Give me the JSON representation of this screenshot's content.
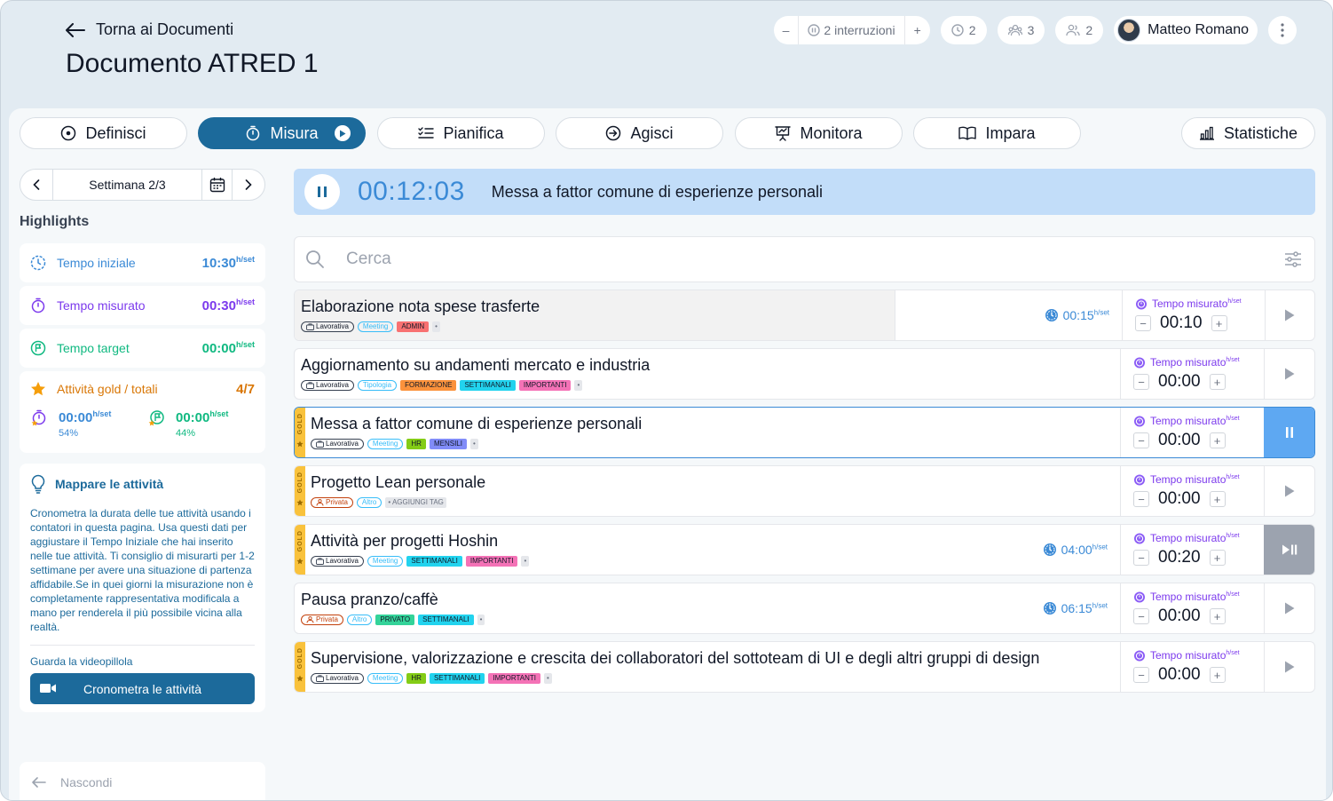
{
  "header": {
    "back_label": "Torna ai Documenti",
    "title": "Documento ATRED 1",
    "interruptions_minus": "–",
    "interruptions_label": "2 interruzioni",
    "interruptions_plus": "+",
    "timers_count": "2",
    "team_count": "3",
    "users_count": "2",
    "user_name": "Matteo Romano"
  },
  "tabs": [
    {
      "label": "Definisci"
    },
    {
      "label": "Misura"
    },
    {
      "label": "Pianifica"
    },
    {
      "label": "Agisci"
    },
    {
      "label": "Monitora"
    },
    {
      "label": "Impara"
    },
    {
      "label": "Statistiche"
    }
  ],
  "sidebar": {
    "week_label": "Settimana 2/3",
    "highlights_title": "Highlights",
    "unit": "h/set",
    "cards": [
      {
        "label": "Tempo iniziale",
        "value": "10:30",
        "color": "#3b8ad6"
      },
      {
        "label": "Tempo misurato",
        "value": "00:30",
        "color": "#7c3aed"
      },
      {
        "label": "Tempo target",
        "value": "00:00",
        "color": "#10b981"
      }
    ],
    "gold": {
      "label": "Attività gold / totali",
      "value": "4/7",
      "color": "#d97706",
      "measured_value": "00:00",
      "measured_pct": "54%",
      "target_value": "00:00",
      "target_pct": "44%"
    },
    "tip": {
      "title": "Mappare le attività",
      "text": "Cronometra la durata delle tue attività usando i contatori in questa pagina. Usa questi dati per aggiustare il Tempo Iniziale che hai inserito nelle tue attività. Ti consiglio di misurarti per 1-2 settimane per avere una situazione di partenza affidabile.Se in quei giorni la misurazione non è completamente rappresentativa modificala a mano per renderela il più possibile vicina alla realtà.",
      "video_label": "Guarda la videopillola",
      "button_label": "Cronometra le attività"
    },
    "hide_label": "Nascondi"
  },
  "timer": {
    "time": "00:12:03",
    "activity": "Messa a fattor comune di esperienze personali"
  },
  "search": {
    "placeholder": "Cerca"
  },
  "measured_label": "Tempo misurato",
  "activities": [
    {
      "name": "Elaborazione nota spese trasferte",
      "gold": false,
      "estimate": "00:15",
      "measured": "00:10",
      "action": "play",
      "tags": [
        {
          "t": "Lavorativa",
          "k": "o"
        },
        {
          "t": "Meeting",
          "k": "b"
        },
        {
          "t": "ADMIN",
          "k": "s",
          "c": "#f87171"
        },
        {
          "t": "•",
          "k": "x"
        }
      ]
    },
    {
      "name": "Aggiornamento su andamenti mercato e industria",
      "gold": false,
      "estimate": "",
      "measured": "00:00",
      "action": "play",
      "tags": [
        {
          "t": "Lavorativa",
          "k": "o"
        },
        {
          "t": "Tipologia",
          "k": "b"
        },
        {
          "t": "FORMAZIONE",
          "k": "s",
          "c": "#fb923c"
        },
        {
          "t": "SETTIMANALI",
          "k": "s",
          "c": "#22d3ee"
        },
        {
          "t": "IMPORTANTI",
          "k": "s",
          "c": "#f472b6"
        },
        {
          "t": "•",
          "k": "x"
        }
      ]
    },
    {
      "name": "Messa a fattor comune di esperienze personali",
      "gold": true,
      "estimate": "",
      "measured": "00:00",
      "action": "pause",
      "tags": [
        {
          "t": "Lavorativa",
          "k": "o"
        },
        {
          "t": "Meeting",
          "k": "b"
        },
        {
          "t": "HR",
          "k": "s",
          "c": "#84cc16"
        },
        {
          "t": "MENSILI",
          "k": "s",
          "c": "#818cf8"
        },
        {
          "t": "•",
          "k": "x"
        }
      ]
    },
    {
      "name": "Progetto Lean personale",
      "gold": true,
      "estimate": "",
      "measured": "00:00",
      "action": "play",
      "tags": [
        {
          "t": "Privata",
          "k": "or"
        },
        {
          "t": "Altro",
          "k": "b"
        },
        {
          "t": "• AGGIUNGI TAG",
          "k": "x"
        }
      ]
    },
    {
      "name": "Attività per progetti Hoshin",
      "gold": true,
      "estimate": "04:00",
      "measured": "00:20",
      "action": "playpause",
      "tags": [
        {
          "t": "Lavorativa",
          "k": "o"
        },
        {
          "t": "Meeting",
          "k": "b"
        },
        {
          "t": "SETTIMANALI",
          "k": "s",
          "c": "#22d3ee"
        },
        {
          "t": "IMPORTANTI",
          "k": "s",
          "c": "#f472b6"
        },
        {
          "t": "•",
          "k": "x"
        }
      ]
    },
    {
      "name": "Pausa pranzo/caffè",
      "gold": false,
      "estimate": "06:15",
      "measured": "00:00",
      "action": "play",
      "tags": [
        {
          "t": "Privata",
          "k": "or"
        },
        {
          "t": "Altro",
          "k": "b"
        },
        {
          "t": "PRIVATO",
          "k": "s",
          "c": "#34d399"
        },
        {
          "t": "SETTIMANALI",
          "k": "s",
          "c": "#22d3ee"
        },
        {
          "t": "•",
          "k": "x"
        }
      ]
    },
    {
      "name": "Supervisione, valorizzazione e crescita dei collaboratori del sottoteam di UI e degli altri gruppi di design",
      "gold": true,
      "estimate": "",
      "measured": "00:00",
      "action": "play",
      "tags": [
        {
          "t": "Lavorativa",
          "k": "o"
        },
        {
          "t": "Meeting",
          "k": "b"
        },
        {
          "t": "HR",
          "k": "s",
          "c": "#84cc16"
        },
        {
          "t": "SETTIMANALI",
          "k": "s",
          "c": "#22d3ee"
        },
        {
          "t": "IMPORTANTI",
          "k": "s",
          "c": "#f472b6"
        },
        {
          "t": "•",
          "k": "x"
        }
      ]
    }
  ],
  "gold_label": "GOLD"
}
